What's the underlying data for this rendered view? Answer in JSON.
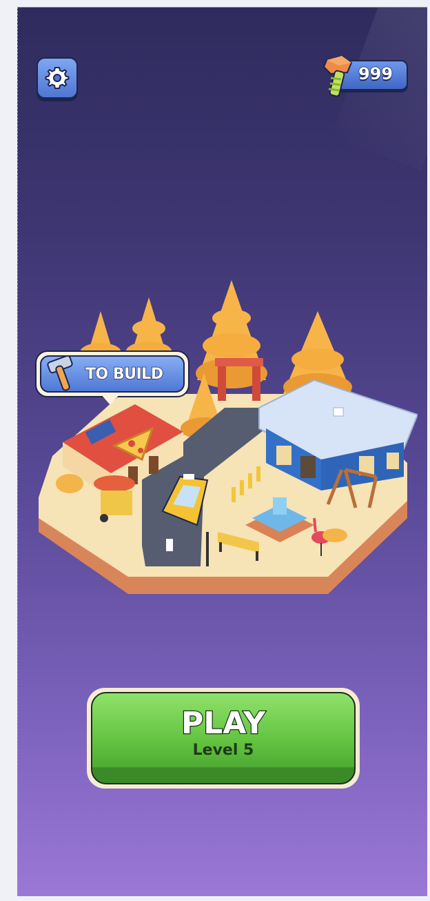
{
  "hud": {
    "currency_value": "999",
    "currency_icon": "bolt-icon",
    "settings_icon": "gear-icon"
  },
  "build_bubble": {
    "label": "TO BUILD",
    "icon": "hammer-icon"
  },
  "play": {
    "title": "PLAY",
    "level": "Level 5"
  },
  "colors": {
    "background_top": "#2f2b5e",
    "background_bottom": "#9b78d6",
    "button_blue": "#5b83dc",
    "play_green": "#62c23f",
    "outline": "#1c2450"
  }
}
